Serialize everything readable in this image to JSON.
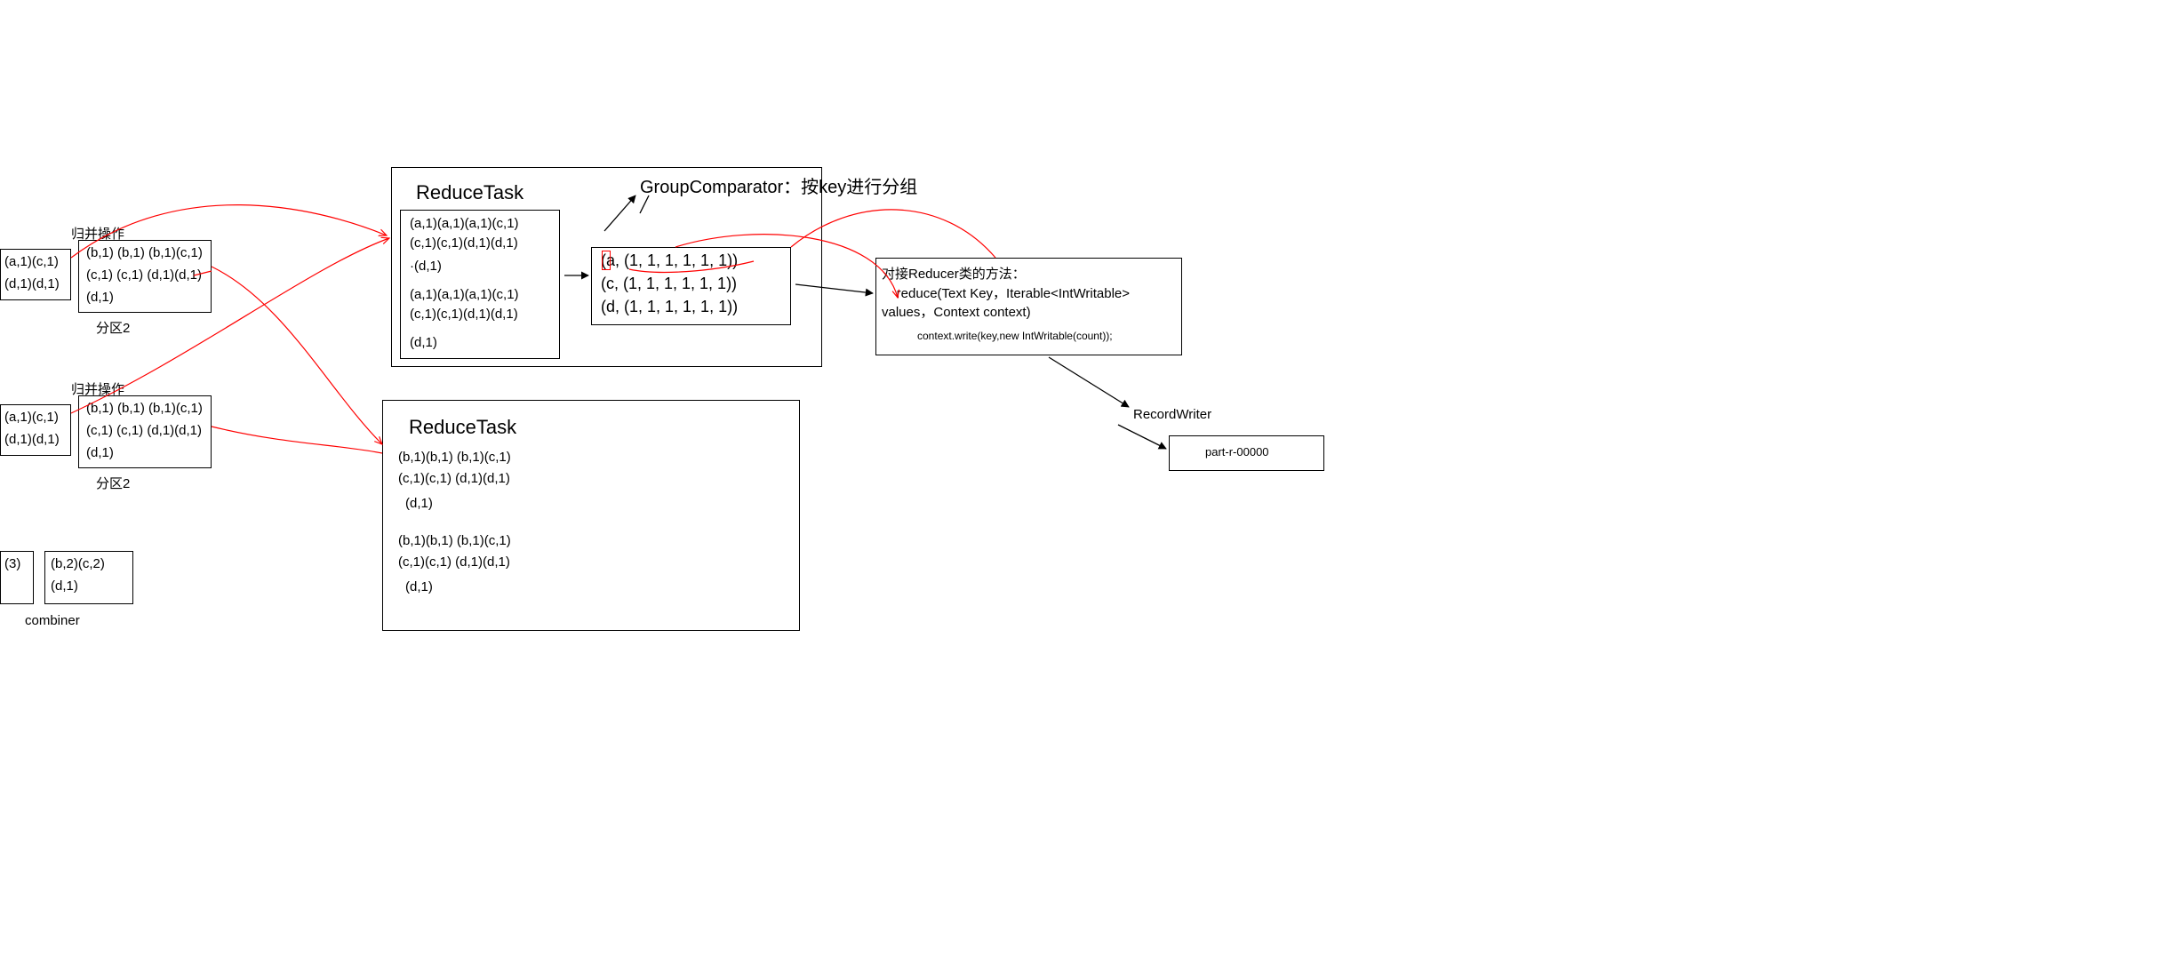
{
  "labels": {
    "merge_op_1": "归并操作",
    "merge_op_2": "归并操作",
    "partition_1": "分区2",
    "partition_2": "分区2",
    "combiner": "combiner",
    "group_comparator": "GroupComparator：按key进行分组",
    "reducer_method_title": "对接Reducer类的方法：",
    "reducer_method_sig": "    reduce(Text Key，Iterable<IntWritable> values，Context context)",
    "reducer_method_body": "            context.write(key,new IntWritable(count));",
    "record_writer": "RecordWriter",
    "part_file": "part-r-00000"
  },
  "kv_left_small_1": "(a,1)(c,1)",
  "kv_left_small_2": "(d,1)(d,1)",
  "partition1_col1_r1": "(a,1)(c,1)",
  "partition1_col1_r2": "(d,1)(d,1)",
  "partition1_col2_r1": "(b,1) (b,1) (b,1)(c,1)",
  "partition1_col2_r2": "(c,1) (c,1) (d,1)(d,1)",
  "partition1_col2_r3": "(d,1)",
  "partition2_col1_r1": "(a,1)(c,1)",
  "partition2_col1_r2": "(d,1)(d,1)",
  "partition2_col2_r1": "(b,1) (b,1) (b,1)(c,1)",
  "partition2_col2_r2": "(c,1) (c,1) (d,1)(d,1)",
  "partition2_col2_r3": "(d,1)",
  "combiner_box1_r1": "(3)",
  "combiner_box2_r1": "(b,2)(c,2)",
  "combiner_box2_r2": "(d,1)",
  "reduce1_title": "ReduceTask",
  "reduce1_block_r1": "(a,1)(a,1)(a,1)(c,1)",
  "reduce1_block_r2": "(c,1)(c,1)(d,1)(d,1)",
  "reduce1_block_r3": "·(d,1)",
  "reduce1_block_r4": "(a,1)(a,1)(a,1)(c,1)",
  "reduce1_block_r5": "(c,1)(c,1)(d,1)(d,1)",
  "reduce1_block_r6": "(d,1)",
  "group_r1": "(a, (1, 1, 1, 1, 1, 1))",
  "group_r2": "(c, (1, 1, 1, 1, 1, 1))",
  "group_r3": "(d, (1, 1, 1, 1, 1, 1))",
  "reduce2_title": "ReduceTask",
  "reduce2_r1": "(b,1)(b,1) (b,1)(c,1)",
  "reduce2_r2": "(c,1)(c,1) (d,1)(d,1)",
  "reduce2_r3": "(d,1)",
  "reduce2_r4": "(b,1)(b,1) (b,1)(c,1)",
  "reduce2_r5": "(c,1)(c,1) (d,1)(d,1)",
  "reduce2_r6": "(d,1)"
}
